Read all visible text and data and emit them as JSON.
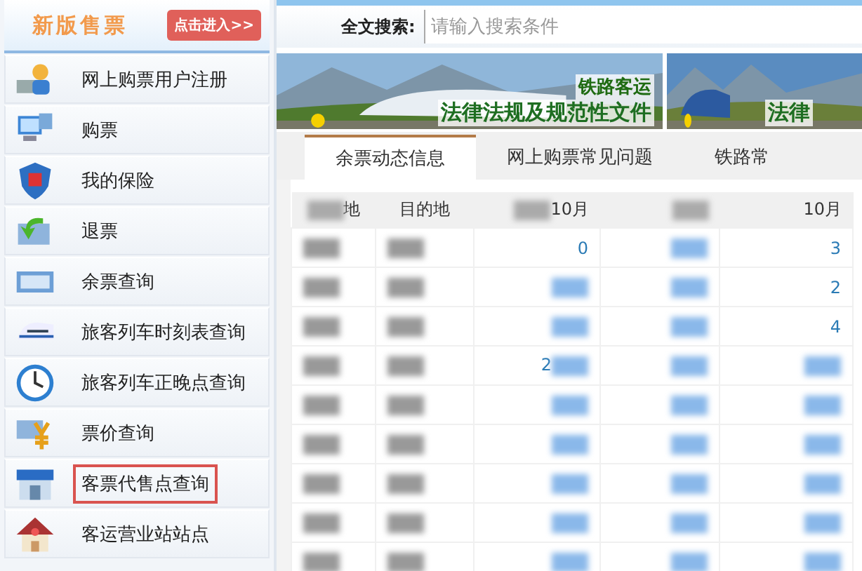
{
  "sidebar": {
    "title": "新版售票",
    "enter_button": "点击进入>>",
    "items": [
      {
        "label": "网上购票用户注册",
        "highlighted": false
      },
      {
        "label": "购票",
        "highlighted": false
      },
      {
        "label": "我的保险",
        "highlighted": false
      },
      {
        "label": "退票",
        "highlighted": false
      },
      {
        "label": "余票查询",
        "highlighted": false
      },
      {
        "label": "旅客列车时刻表查询",
        "highlighted": false
      },
      {
        "label": "旅客列车正晚点查询",
        "highlighted": false
      },
      {
        "label": "票价查询",
        "highlighted": false
      },
      {
        "label": "客票代售点查询",
        "highlighted": true
      },
      {
        "label": "客运营业站站点",
        "highlighted": false
      }
    ]
  },
  "search": {
    "label": "全文搜索:",
    "placeholder": "请输入搜索条件"
  },
  "banners": [
    {
      "kind": "picture",
      "subtitle": "铁路客运",
      "title": "法律法规及规范性文件"
    },
    {
      "kind": "picture",
      "title": "法律"
    }
  ],
  "tabs": [
    {
      "label": "余票动态信息",
      "selected": true
    },
    {
      "label": "网上购票常见问题",
      "selected": false
    },
    {
      "label": "铁路常",
      "selected": false
    }
  ],
  "table": {
    "columns": [
      {
        "label": "地",
        "blurred": true
      },
      {
        "label": "目的地",
        "blurred": false
      },
      {
        "label": "10月",
        "blurred": true
      },
      {
        "blurred": true
      },
      {
        "label": "10月",
        "blurred": false
      }
    ],
    "rows": [
      [
        {
          "blurred": true
        },
        {
          "blurred": true
        },
        {
          "text": "0",
          "blurred": false
        },
        {
          "blurred": true
        },
        {
          "text": "3",
          "blurred": false
        }
      ],
      [
        {
          "blurred": true
        },
        {
          "blurred": true
        },
        {
          "blurred": true
        },
        {
          "blurred": true
        },
        {
          "text": "2",
          "blurred": false
        }
      ],
      [
        {
          "blurred": true
        },
        {
          "blurred": true
        },
        {
          "blurred": true
        },
        {
          "blurred": true
        },
        {
          "text": "4",
          "blurred": false
        }
      ],
      [
        {
          "blurred": true
        },
        {
          "blurred": true
        },
        {
          "text": "2",
          "blurred": true
        },
        {
          "blurred": true
        },
        {
          "blurred": true
        }
      ],
      [
        {
          "blurred": true
        },
        {
          "blurred": true
        },
        {
          "blurred": true
        },
        {
          "blurred": true
        },
        {
          "blurred": true
        }
      ],
      [
        {
          "blurred": true
        },
        {
          "blurred": true
        },
        {
          "blurred": true
        },
        {
          "blurred": true
        },
        {
          "blurred": true
        }
      ],
      [
        {
          "blurred": true
        },
        {
          "blurred": true
        },
        {
          "blurred": true
        },
        {
          "blurred": true
        },
        {
          "blurred": true
        }
      ],
      [
        {
          "blurred": true
        },
        {
          "blurred": true
        },
        {
          "blurred": true
        },
        {
          "blurred": true
        },
        {
          "blurred": true
        }
      ],
      [
        {
          "blurred": true
        },
        {
          "blurred": true
        },
        {
          "blurred": true
        },
        {
          "blurred": true
        },
        {
          "blurred": true
        }
      ]
    ]
  }
}
